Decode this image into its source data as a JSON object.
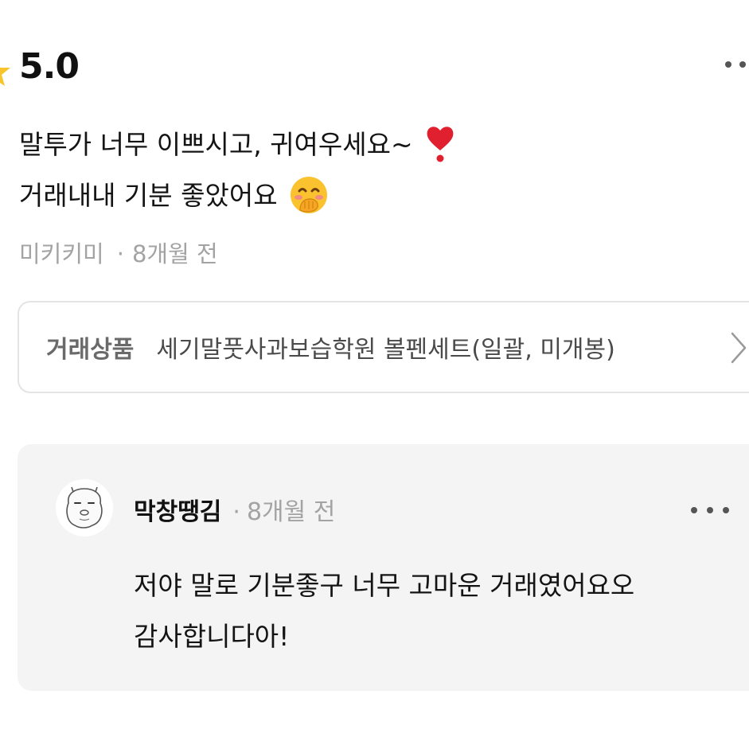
{
  "review": {
    "rating": "5.0",
    "text_line1": "말투가 너무 이쁘시고, 귀여우세요~",
    "text_line2": "거래내내 기분 좋았어요",
    "author": "미키키미",
    "separator": "·",
    "time": "8개월 전"
  },
  "product": {
    "label": "거래상품",
    "name": "세기말풋사과보습학원 볼펜세트(일괄, 미개봉)"
  },
  "reply": {
    "author": "막창땡김",
    "separator": "·",
    "time": "8개월 전",
    "text_line1": "저야 말로 기분좋구 너무 고마운 거래였어요오",
    "text_line2": "감사합니다아!"
  },
  "icons": {
    "star": "star-icon",
    "more": "more-horizontal-icon",
    "heart": "red-heart-emoji",
    "face": "face-with-hand-over-mouth-emoji",
    "chevron": "chevron-right-icon"
  },
  "colors": {
    "star": "#f7c52b",
    "heart": "#e0202e",
    "muted_text": "#a3a3a3",
    "card_bg": "#f4f4f4"
  }
}
